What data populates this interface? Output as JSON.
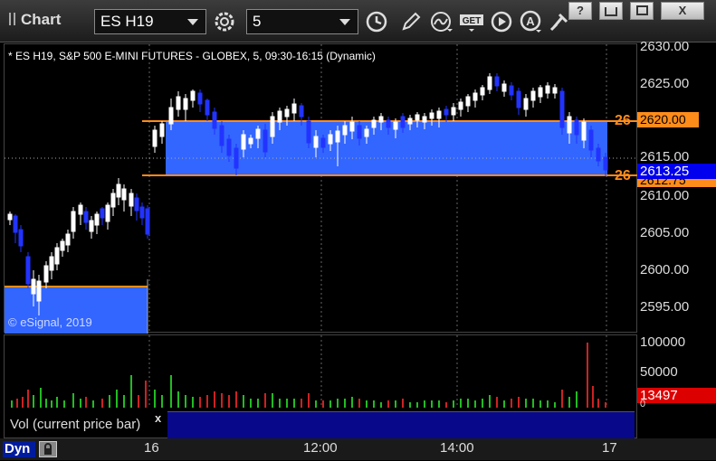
{
  "window": {
    "title": "Chart",
    "buttons": [
      "?",
      "□",
      "□",
      "X"
    ]
  },
  "toolbar": {
    "symbol": "ES H19",
    "interval": "5",
    "icons": [
      "settings-gear-icon",
      "clock-icon",
      "pencil-icon",
      "study-icon",
      "get-icon",
      "play-icon",
      "a-icon",
      "pin-icon"
    ]
  },
  "chart": {
    "header": "* ES H19, S&P 500 E-MINI FUTURES - GLOBEX, 5, 09:30-16:15 (Dynamic)",
    "watermark": "© eSignal, 2019",
    "price_ticks": [
      "2630.00",
      "2625.00",
      "2620.00",
      "2615.00",
      "2610.00",
      "2605.00",
      "2600.00",
      "2595.00"
    ],
    "zone_label_top": "26",
    "zone_label_bottom": "26",
    "price_flag_upper": "2620.00",
    "price_flag_current": "2613.25",
    "price_flag_behind": "2612.75",
    "colors": {
      "zone": "#3366ff",
      "zone_line": "#ff8c1a",
      "candle_up": "#ffffff",
      "candle_down": "#1a1aff",
      "current_flag": "#0000ee"
    },
    "chart_data": {
      "type": "candlestick",
      "ylim": [
        2593,
        2632
      ],
      "zone_upper": [
        2620.0,
        2597.75
      ],
      "zone_lower": [
        2612.75,
        2593.0
      ],
      "current": 2613.25
    }
  },
  "volume": {
    "label": "Vol (current price bar)",
    "close": "x",
    "ticks": [
      "100000",
      "50000",
      "0"
    ],
    "current_value": "13497",
    "colors": {
      "up": "#22bb22",
      "down": "#cc2222",
      "value_bg": "#dd0000"
    }
  },
  "time_axis": {
    "labels": [
      "16",
      "12:00",
      "14:00",
      "17"
    ],
    "status": "Dyn"
  }
}
